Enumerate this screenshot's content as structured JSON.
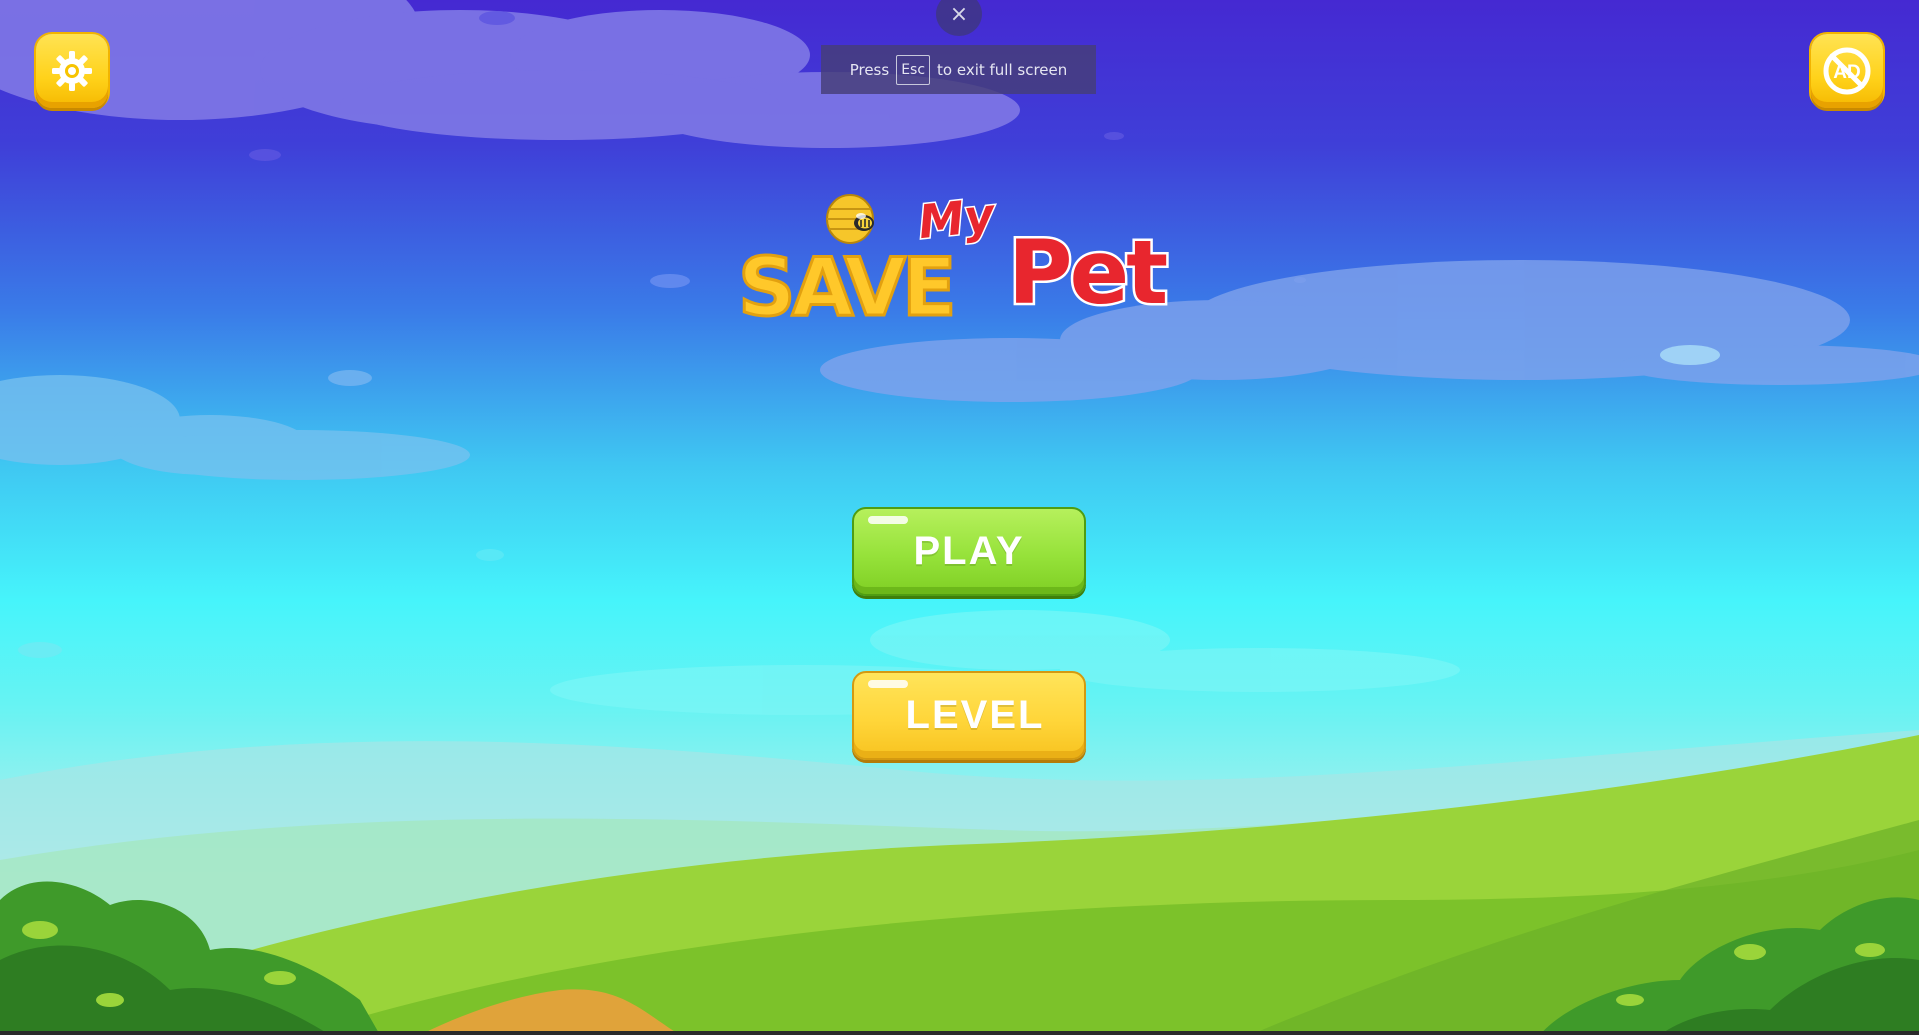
{
  "fullscreen_notice": {
    "close_glyph": "×",
    "before": "Press",
    "key": "Esc",
    "after": "to exit full screen"
  },
  "toolbar": {
    "settings_icon": "gear-icon",
    "noads_icon": "no-ads-icon",
    "noads_text": "AD"
  },
  "logo": {
    "word_save": "SAVE",
    "word_my": "My",
    "word_pet": "Pet"
  },
  "menu": {
    "play_label": "PLAY",
    "level_label": "LEVEL"
  },
  "colors": {
    "sky_top": "#4529d2",
    "sky_bottom": "#46f4fb",
    "button_yellow": "#ffd21a",
    "button_green": "#96e23a",
    "logo_red": "#e8262e",
    "logo_yellow": "#ffc82a"
  }
}
